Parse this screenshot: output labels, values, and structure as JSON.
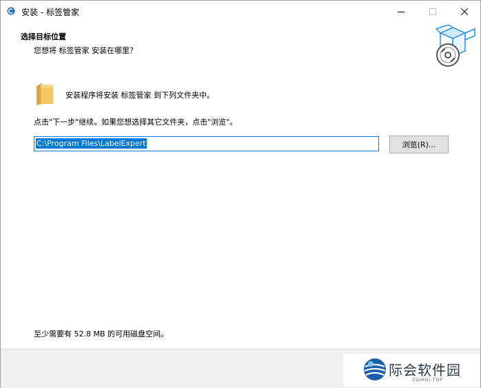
{
  "window": {
    "title": "安装 -  标签管家",
    "controls": {
      "minimize_icon": "minimize-icon",
      "maximize_icon": "maximize-icon",
      "close_icon": "close-icon"
    }
  },
  "header": {
    "title": "选择目标位置",
    "subtitle": "您想将 标签管家 安装在哪里？",
    "graphic_icon": "install-box-disc-icon"
  },
  "main": {
    "folder_icon": "folder-icon",
    "install_info": "安装程序将安装 标签管家 到下列文件夹中。",
    "instruction": "点击\"下一步\"继续。如果您想选择其它文件夹，点击\"浏览\"。",
    "path_value": "C:\\Program Files\\LabelExpert",
    "browse_label": "浏览(R)...",
    "space_info": "至少需要有 52.8 MB 的可用磁盘空间。"
  },
  "watermark": {
    "text": "际会软件园",
    "subtext": "ZUIHUI.TOP"
  },
  "colors": {
    "accent": "#0078d7",
    "folder": "#f6c566",
    "footer_bg": "#f0f0f0",
    "button_bg": "#e1e1e1"
  }
}
